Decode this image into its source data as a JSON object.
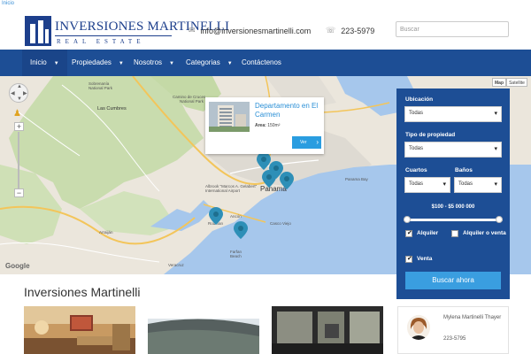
{
  "topbar": {
    "breadcrumb": "Inicio"
  },
  "header": {
    "logo_name": "INVERSIONES MARTINELLI",
    "logo_sub": "REAL ESTATE",
    "email": "info@inversionesmartinelli.com",
    "phone": "223-5979",
    "search_placeholder": "Buscar"
  },
  "nav": {
    "items": [
      {
        "label": "Inicio",
        "has_caret": true
      },
      {
        "label": "Propiedades",
        "has_caret": true
      },
      {
        "label": "Nosotros",
        "has_caret": true
      },
      {
        "label": "Categorias",
        "has_caret": true
      },
      {
        "label": "Contáctenos",
        "has_caret": false
      }
    ]
  },
  "map": {
    "type_buttons": [
      "Map",
      "Satellite"
    ],
    "attribution": "Google",
    "place_labels": [
      "Sobrenanía National Park",
      "Camino de Cruces National Park",
      "Las Cumbres",
      "Albrook \"Marcos A. Gelabert\" International Airport",
      "Panamá",
      "Panama Bay",
      "Casco Viejo",
      "Arraiján",
      "Farfan Beach",
      "Veracruz",
      "Ancón",
      "Rodman"
    ],
    "info_window": {
      "title": "Departamento en El Carmen",
      "area_label": "Area:",
      "area_value": "150m²",
      "button_label": "Ver"
    }
  },
  "search_panel": {
    "ubicacion_label": "Ubicación",
    "ubicacion_value": "Todas",
    "tipo_label": "Tipo de propiedad",
    "tipo_value": "Todas",
    "cuartos_label": "Cuartos",
    "cuartos_value": "Todas",
    "banos_label": "Baños",
    "banos_value": "Todas",
    "price_range": "$100 - $5 000 000",
    "price_min_fraction": 0.0,
    "price_max_fraction": 1.0,
    "alquiler_label": "Alquiler",
    "alquiler_checked": true,
    "alquiler_venta_label": "Alquiler o venta",
    "alquiler_venta_checked": false,
    "venta_label": "Venta",
    "venta_checked": true,
    "submit_label": "Buscar ahora"
  },
  "listing": {
    "section_title": "Inversiones Martinelli"
  },
  "agent": {
    "name": "Mylena Martinelli Thayer",
    "phone": "223-5795"
  },
  "colors": {
    "nav_blue": "#1d4e95",
    "accent_blue": "#3a9ee0",
    "link_blue": "#2a8fd6"
  }
}
